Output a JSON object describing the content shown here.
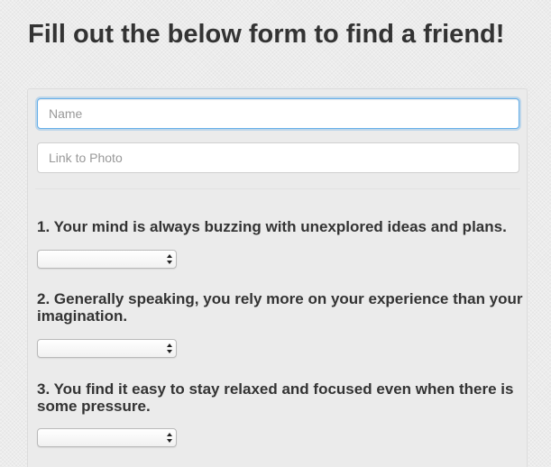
{
  "page": {
    "title": "Fill out the below form to find a friend!"
  },
  "form": {
    "name_placeholder": "Name",
    "photo_placeholder": "Link to Photo",
    "questions": [
      {
        "text": "1. Your mind is always buzzing with unexplored ideas and plans.",
        "selected": ""
      },
      {
        "text": "2. Generally speaking, you rely more on your experience than your imagination.",
        "selected": ""
      },
      {
        "text": "3. You find it easy to stay relaxed and focused even when there is some pressure.",
        "selected": ""
      }
    ]
  },
  "colors": {
    "focus_border": "#66afe9",
    "panel_background": "#ebebeb"
  }
}
